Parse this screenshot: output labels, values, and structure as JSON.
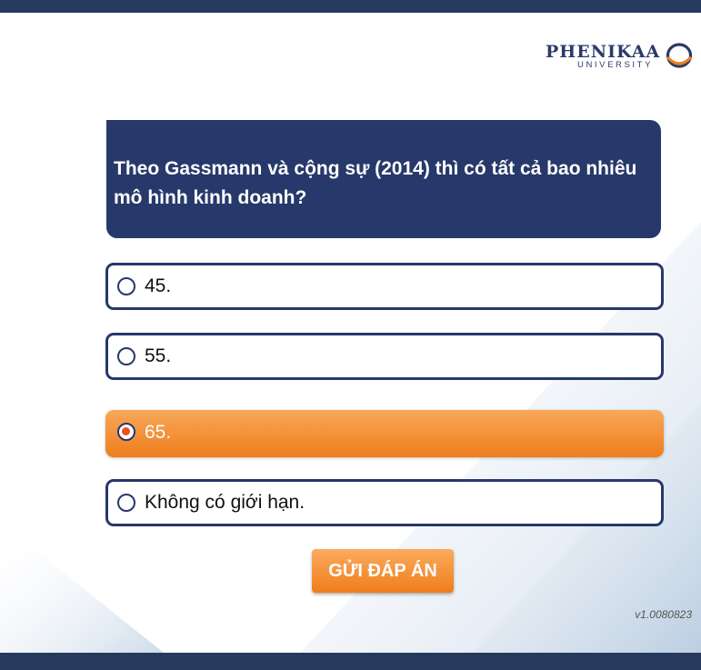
{
  "brand": {
    "name": "PHENIKAA",
    "subtitle": "UNIVERSITY",
    "primary_color": "#27386a",
    "accent_color": "#ef7d1c"
  },
  "question": {
    "text": "Theo Gassmann và cộng sự (2014) thì có tất cả bao nhiêu mô hình kinh doanh?"
  },
  "options": [
    {
      "label": "45.",
      "selected": false
    },
    {
      "label": "55.",
      "selected": false
    },
    {
      "label": "65.",
      "selected": true
    },
    {
      "label": "Không có giới hạn.",
      "selected": false
    }
  ],
  "submit_label": "GỬI ĐÁP ÁN",
  "version": "v1.0080823"
}
